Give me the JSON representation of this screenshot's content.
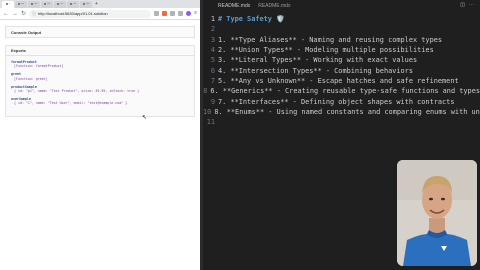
{
  "browser": {
    "tabs": [
      {
        "label": "C"
      },
      {
        "label": "co"
      },
      {
        "label": "co"
      },
      {
        "label": "co"
      },
      {
        "label": "co"
      },
      {
        "label": "co"
      },
      {
        "label": "co"
      }
    ],
    "new_tab": "+",
    "url": "http://localhost:5630/app/01.01.solution",
    "console_title": "Console Output",
    "exports_title": "Exports",
    "exports": [
      {
        "name": "formatProduct",
        "value": "[Function: formatProduct]"
      },
      {
        "name": "greet",
        "value": "[Function: greet]"
      },
      {
        "name": "productSample",
        "value": "{ id: \"p1\", name: \"Test Product\", price: 49.99, inStock: true }"
      },
      {
        "name": "userSample",
        "value": "{ id: \"1\", name: \"Test User\", email: \"test@example.com\" }"
      }
    ]
  },
  "editor": {
    "tabs": [
      "README.mdx",
      "README.mdx"
    ],
    "lines": [
      {
        "n": "1",
        "text": "# Type Safety 🛡️"
      },
      {
        "n": "2",
        "text": ""
      },
      {
        "n": "3",
        "text": "1. **Type Aliases** - Naming and reusing complex types"
      },
      {
        "n": "4",
        "text": "2. **Union Types** - Modeling multiple possibilities"
      },
      {
        "n": "5",
        "text": "3. **Literal Types** - Working with exact values"
      },
      {
        "n": "6",
        "text": "4. **Intersection Types** - Combining behaviors"
      },
      {
        "n": "7",
        "text": "5. **Any vs Unknown** - Escape hatches and safe refinement"
      },
      {
        "n": "8",
        "text": "6. **Generics** - Creating reusable type-safe functions and types"
      },
      {
        "n": "9",
        "text": "7. **Interfaces** - Defining object shapes with contracts"
      },
      {
        "n": "10",
        "text": "8. **Enums** - Using named constants and comparing enums with unions"
      },
      {
        "n": "11",
        "text": ""
      }
    ]
  }
}
